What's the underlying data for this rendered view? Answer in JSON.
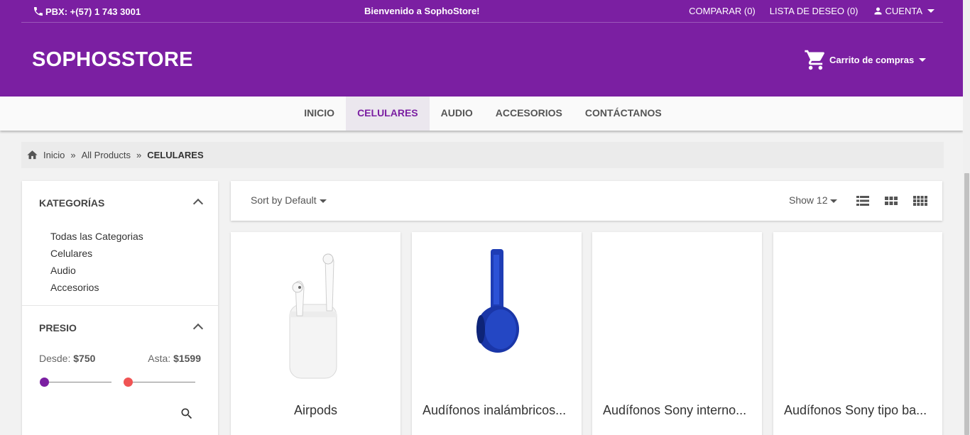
{
  "header": {
    "phone": "PBX: +(57) 1 743 3001",
    "welcome": "Bienvenido a SophoStore!",
    "compare": "COMPARAR (0)",
    "wishlist": "LISTA DE DESEO (0)",
    "account": "CUENTA",
    "brand": "SOPHOSSTORE",
    "cart": "Carrito de compras",
    "color": "#7b1fa2"
  },
  "nav": {
    "items": [
      "INICIO",
      "CELULARES",
      "AUDIO",
      "ACCESORIOS",
      "CONTÁCTANOS"
    ],
    "active": "CELULARES"
  },
  "breadcrumb": {
    "home": "Inicio",
    "sep": "»",
    "all": "All Products",
    "current": "CELULARES"
  },
  "sidebar": {
    "categories_title": "KATEGORÍAS",
    "categories": [
      "Todas las Categorias",
      "Celulares",
      "Audio",
      "Accesorios"
    ],
    "price_title": "PRESIO",
    "from_label": "Desde:",
    "from_value": "$750",
    "to_label": "Asta:",
    "to_value": "$1599"
  },
  "toolbar": {
    "sort": "Sort by Default",
    "show": "Show 12"
  },
  "products": [
    {
      "name": "Airpods",
      "image": "airpods-image"
    },
    {
      "name": "Audífonos inalámbricos...",
      "image": "blue-headphones-image"
    },
    {
      "name": "Audífonos Sony interno...",
      "image": ""
    },
    {
      "name": "Audífonos Sony tipo ba...",
      "image": ""
    }
  ]
}
